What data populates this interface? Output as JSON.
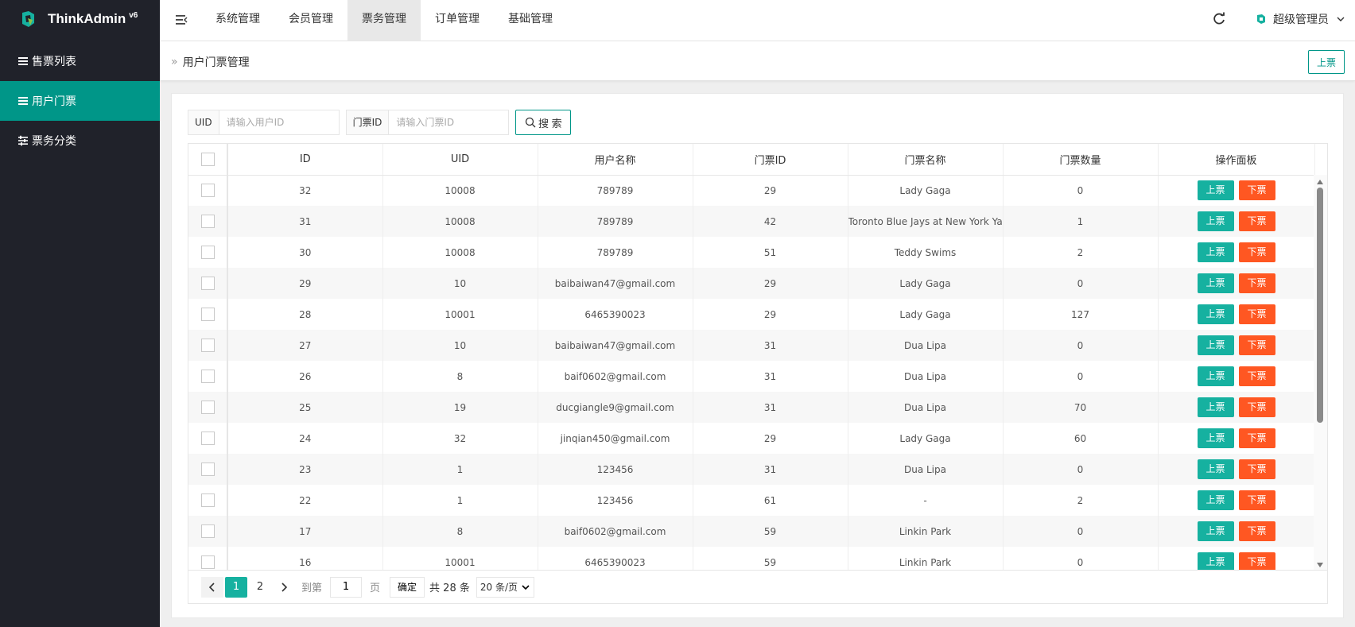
{
  "app": {
    "logo_text": "ThinkAdmin",
    "logo_sup": "v6"
  },
  "sidebar": {
    "items": [
      {
        "label": "售票列表"
      },
      {
        "label": "用户门票"
      },
      {
        "label": "票务分类"
      }
    ]
  },
  "top_nav": {
    "items": [
      {
        "label": "系统管理"
      },
      {
        "label": "会员管理"
      },
      {
        "label": "票务管理"
      },
      {
        "label": "订单管理"
      },
      {
        "label": "基础管理"
      }
    ],
    "user": "超级管理员"
  },
  "breadcrumb": {
    "raquo": "»",
    "title": "用户门票管理",
    "action_label": "上票"
  },
  "search": {
    "uid_label": "UID",
    "uid_placeholder": "请输入用户ID",
    "ticket_label": "门票ID",
    "ticket_placeholder": "请输入门票ID",
    "button_label": "搜 索"
  },
  "table": {
    "columns": [
      "ID",
      "UID",
      "用户名称",
      "门票ID",
      "门票名称",
      "门票数量",
      "操作面板"
    ],
    "up_label": "上票",
    "down_label": "下票",
    "rows": [
      [
        "32",
        "10008",
        "789789",
        "29",
        "Lady Gaga",
        "0"
      ],
      [
        "31",
        "10008",
        "789789",
        "42",
        "Toronto Blue Jays at New York Ya",
        "1"
      ],
      [
        "30",
        "10008",
        "789789",
        "51",
        "Teddy Swims",
        "2"
      ],
      [
        "29",
        "10",
        "baibaiwan47@gmail.com",
        "29",
        "Lady Gaga",
        "0"
      ],
      [
        "28",
        "10001",
        "6465390023",
        "29",
        "Lady Gaga",
        "127"
      ],
      [
        "27",
        "10",
        "baibaiwan47@gmail.com",
        "31",
        "Dua Lipa",
        "0"
      ],
      [
        "26",
        "8",
        "baif0602@gmail.com",
        "31",
        "Dua Lipa",
        "0"
      ],
      [
        "25",
        "19",
        "ducgiangle9@gmail.com",
        "31",
        "Dua Lipa",
        "70"
      ],
      [
        "24",
        "32",
        "jinqian450@gmail.com",
        "29",
        "Lady Gaga",
        "60"
      ],
      [
        "23",
        "1",
        "123456",
        "31",
        "Dua Lipa",
        "0"
      ],
      [
        "22",
        "1",
        "123456",
        "61",
        "-",
        "2"
      ],
      [
        "17",
        "8",
        "baif0602@gmail.com",
        "59",
        "Linkin Park",
        "0"
      ],
      [
        "16",
        "10001",
        "6465390023",
        "59",
        "Linkin Park",
        "0"
      ]
    ]
  },
  "pager": {
    "pages": [
      "1",
      "2"
    ],
    "goto_label": "到第",
    "goto_value": "1",
    "page_unit": "页",
    "confirm_label": "确定",
    "total_text": "共 28 条",
    "page_size": "20 条/页"
  },
  "colors": {
    "brand": "#009688",
    "up": "#16b1a0",
    "down": "#ff5722",
    "sidebar_bg": "#20222a"
  }
}
